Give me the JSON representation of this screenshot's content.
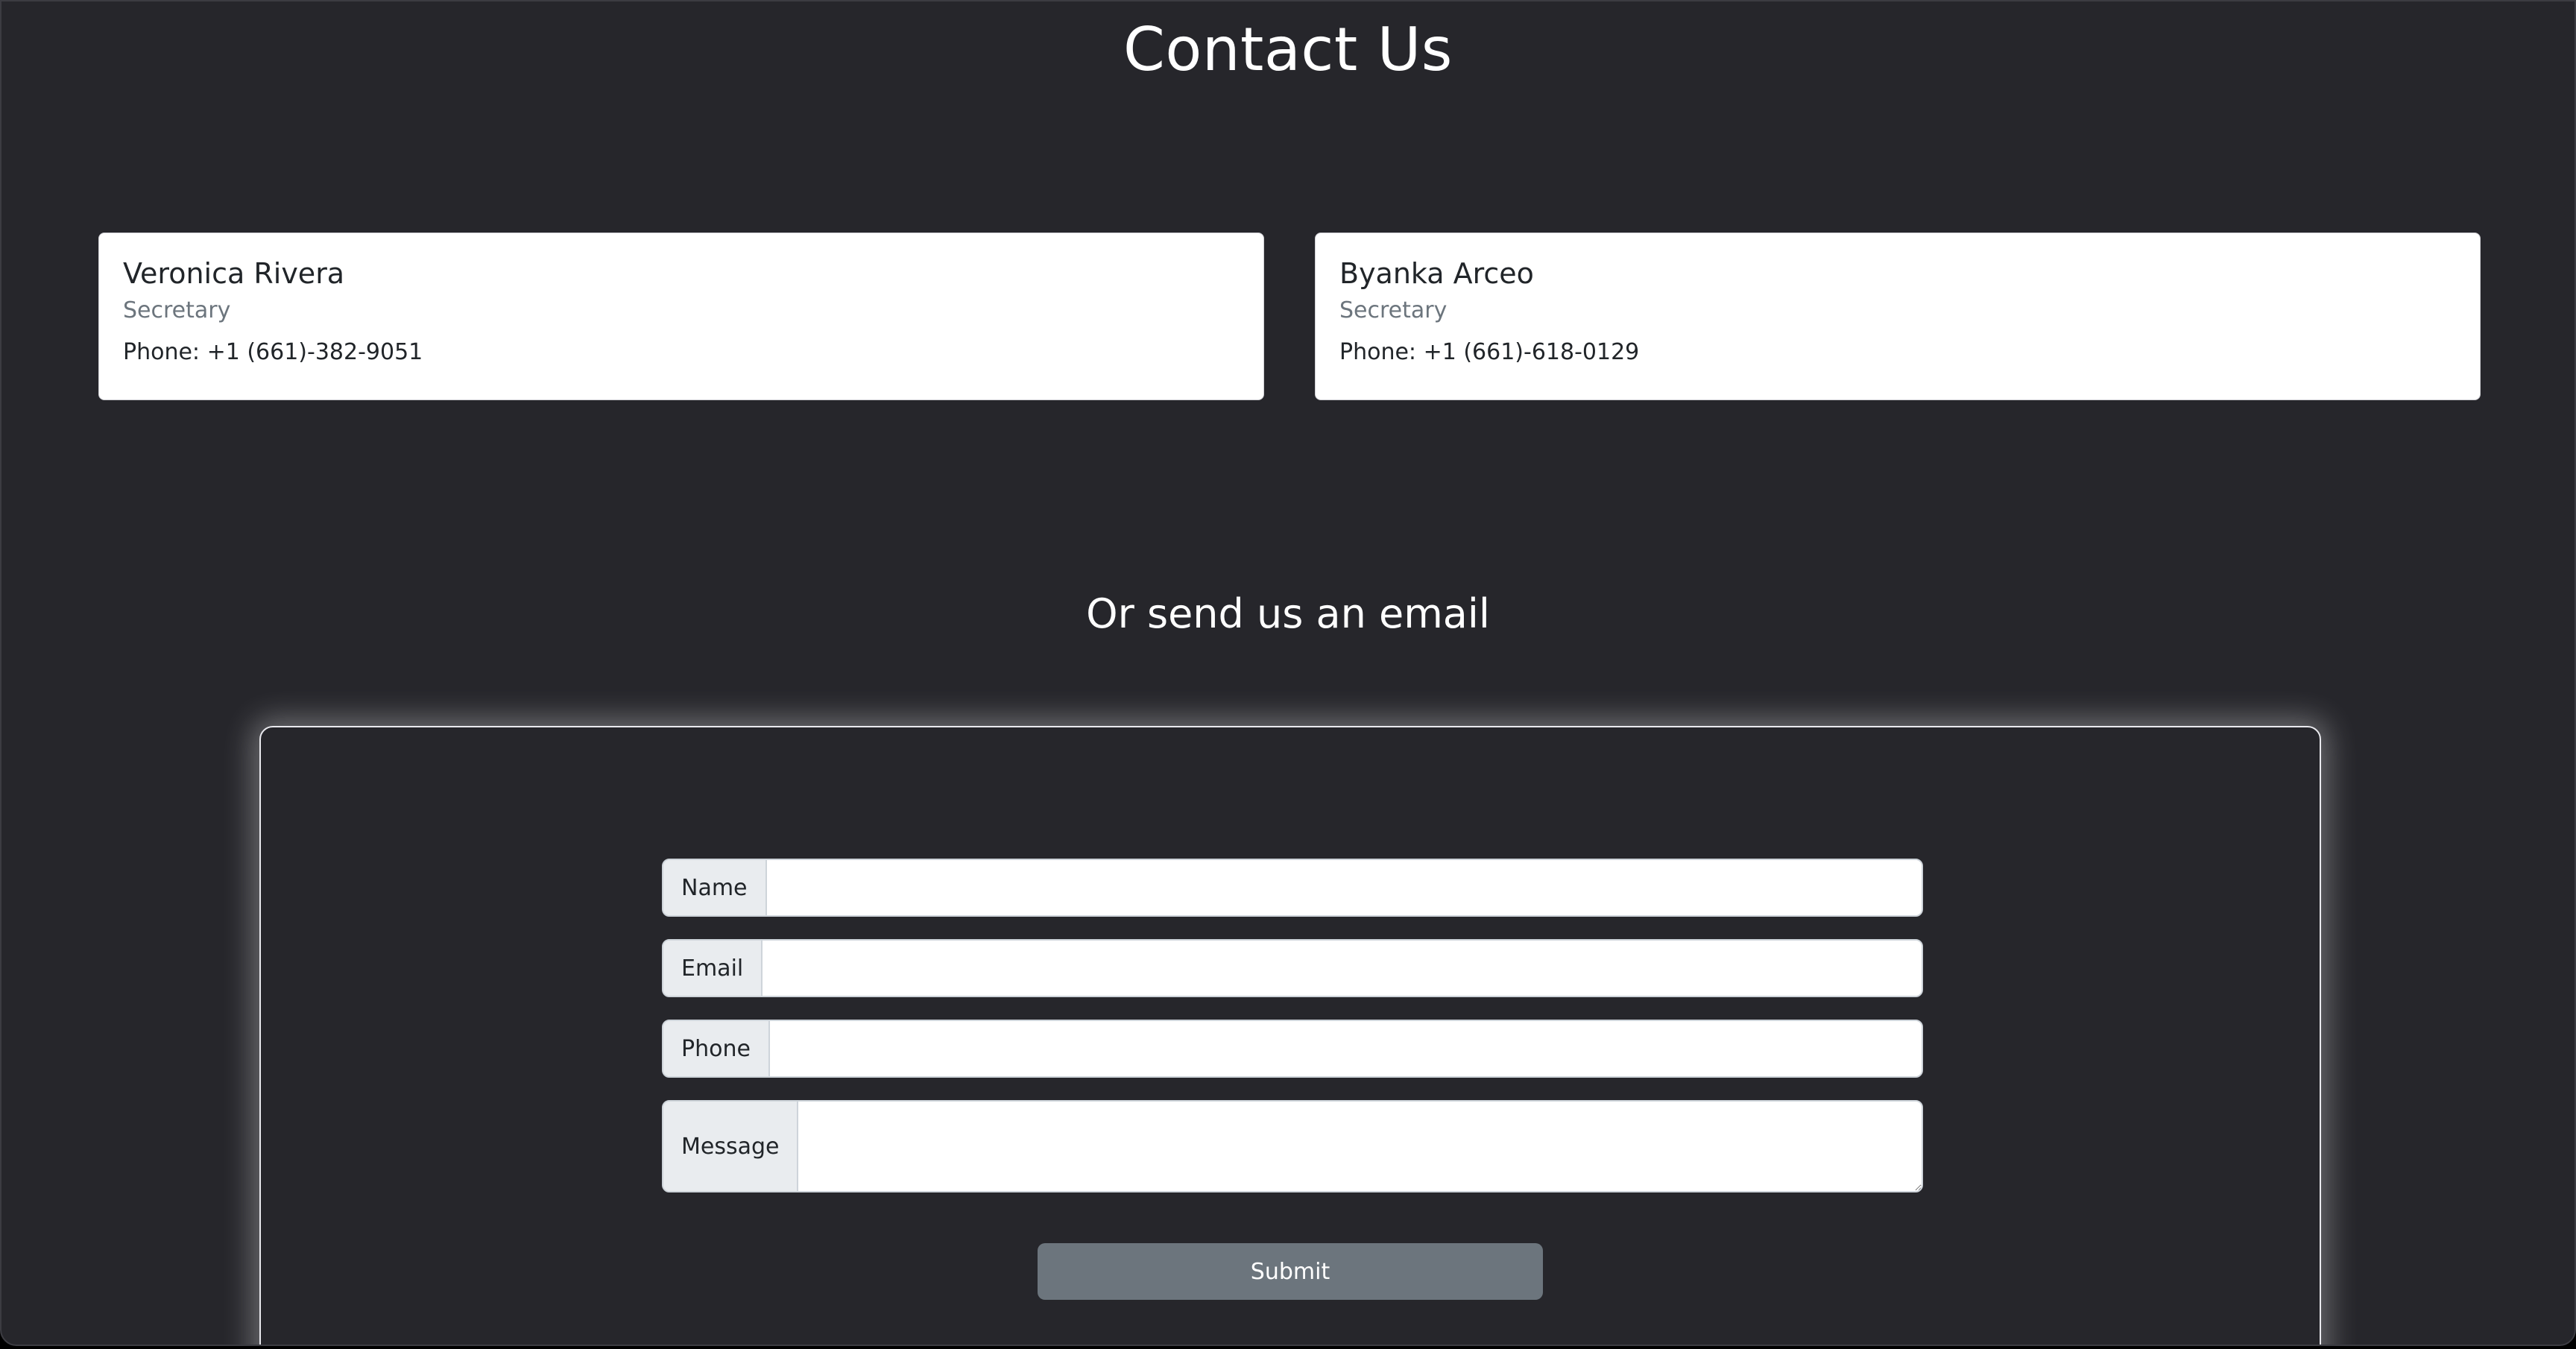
{
  "page": {
    "title": "Contact Us",
    "subtitle": "Or send us an email"
  },
  "contacts": [
    {
      "name": "Veronica Rivera",
      "role": "Secretary",
      "phone": "Phone: +1 (661)-382-9051"
    },
    {
      "name": "Byanka Arceo",
      "role": "Secretary",
      "phone": "Phone: +1 (661)-618-0129"
    }
  ],
  "form": {
    "name_label": "Name",
    "name_value": "",
    "email_label": "Email",
    "email_value": "",
    "phone_label": "Phone",
    "phone_value": "",
    "message_label": "Message",
    "message_value": "",
    "submit_label": "Submit"
  },
  "colors": {
    "background": "#26262b",
    "card_background": "#ffffff",
    "submit_button": "#6c757d",
    "input_group_label": "#e9ecef"
  }
}
